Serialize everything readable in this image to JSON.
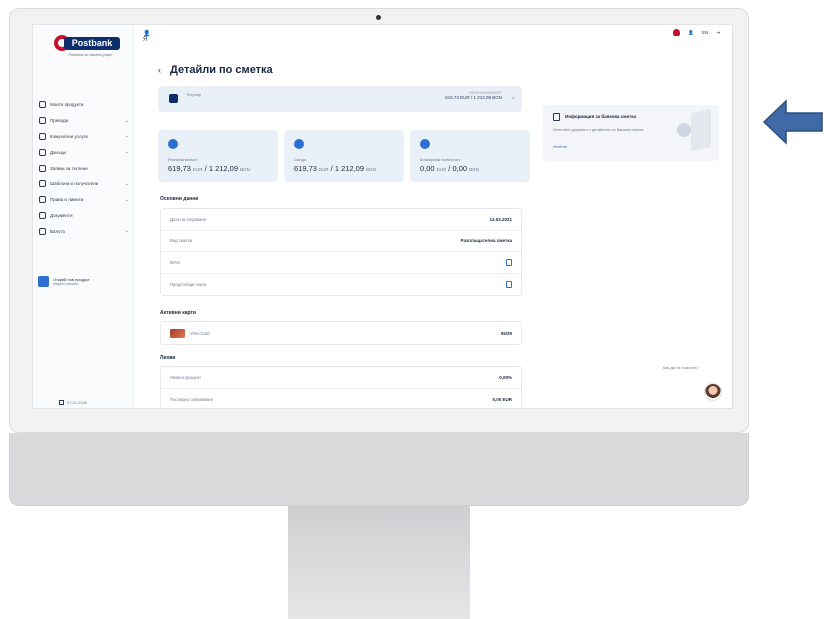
{
  "brand": {
    "name": "Postbank",
    "tagline": "Решения за твоето утре"
  },
  "sidebar": {
    "items": [
      {
        "label": "Моите продукти",
        "chevron": false
      },
      {
        "label": "Преводи",
        "chevron": true
      },
      {
        "label": "Комунални услуги",
        "chevron": true
      },
      {
        "label": "Данъци",
        "chevron": true
      },
      {
        "label": "Заявки за теглене",
        "chevron": false
      },
      {
        "label": "Шаблони и получатели",
        "chevron": true
      },
      {
        "label": "Права и лимити",
        "chevron": true
      },
      {
        "label": "Документи",
        "chevron": false
      },
      {
        "label": "Валута",
        "chevron": true
      }
    ],
    "promo": {
      "title": "Открий нов продукт",
      "subtitle": "Изцяло онлайн"
    },
    "date": "07.01.2026"
  },
  "topbar": {
    "user_initial": "Я",
    "lang": "EN"
  },
  "page": {
    "title": "Детайли по сметка"
  },
  "account": {
    "name": "Титуляр",
    "right_label": "РАЗПОЛАГАЕМОСТ",
    "right_value": "619,73 EUR / 1 212,09 BGN"
  },
  "balances": [
    {
      "label": "Разполагаемост",
      "eur": "619,73",
      "eur_unit": "EUR",
      "bgn": "1 212,09",
      "bgn_unit": "BGN"
    },
    {
      "label": "Салдо",
      "eur": "619,73",
      "eur_unit": "EUR",
      "bgn": "1 212,09",
      "bgn_unit": "BGN"
    },
    {
      "label": "Блокирана наличност",
      "eur": "0,00",
      "eur_unit": "EUR",
      "bgn": "0,00",
      "bgn_unit": "BGN"
    }
  ],
  "basic": {
    "title": "Основни данни",
    "rows": [
      {
        "label": "Дата на откриване",
        "value": "12.03.2021"
      },
      {
        "label": "Вид сметка",
        "value": "Разплащателна сметка"
      },
      {
        "label": "IBAN",
        "value": ""
      },
      {
        "label": "Предстоящи такси",
        "value": ""
      }
    ]
  },
  "cards": {
    "title": "Активни карти",
    "items": [
      {
        "name": "VISA Card",
        "expiry": "05/29"
      }
    ]
  },
  "interest": {
    "title": "Лихви",
    "rows": [
      {
        "label": "Лихвен процент",
        "value": "0,00%"
      },
      {
        "label": "Последно олихвяване",
        "value": "0,00 EUR"
      }
    ]
  },
  "info": {
    "title": "Информация за банкова сметка",
    "text": "Изтеглете документ с детайлите на Вашата сметка",
    "link": "Изтегли"
  },
  "chat": {
    "prompt": "Как да ти помогна?"
  },
  "colors": {
    "brand_navy": "#0d2d6b",
    "brand_red": "#c8102e",
    "accent_blue": "#2e6fd1",
    "arrow_blue": "#3f6aa6"
  }
}
